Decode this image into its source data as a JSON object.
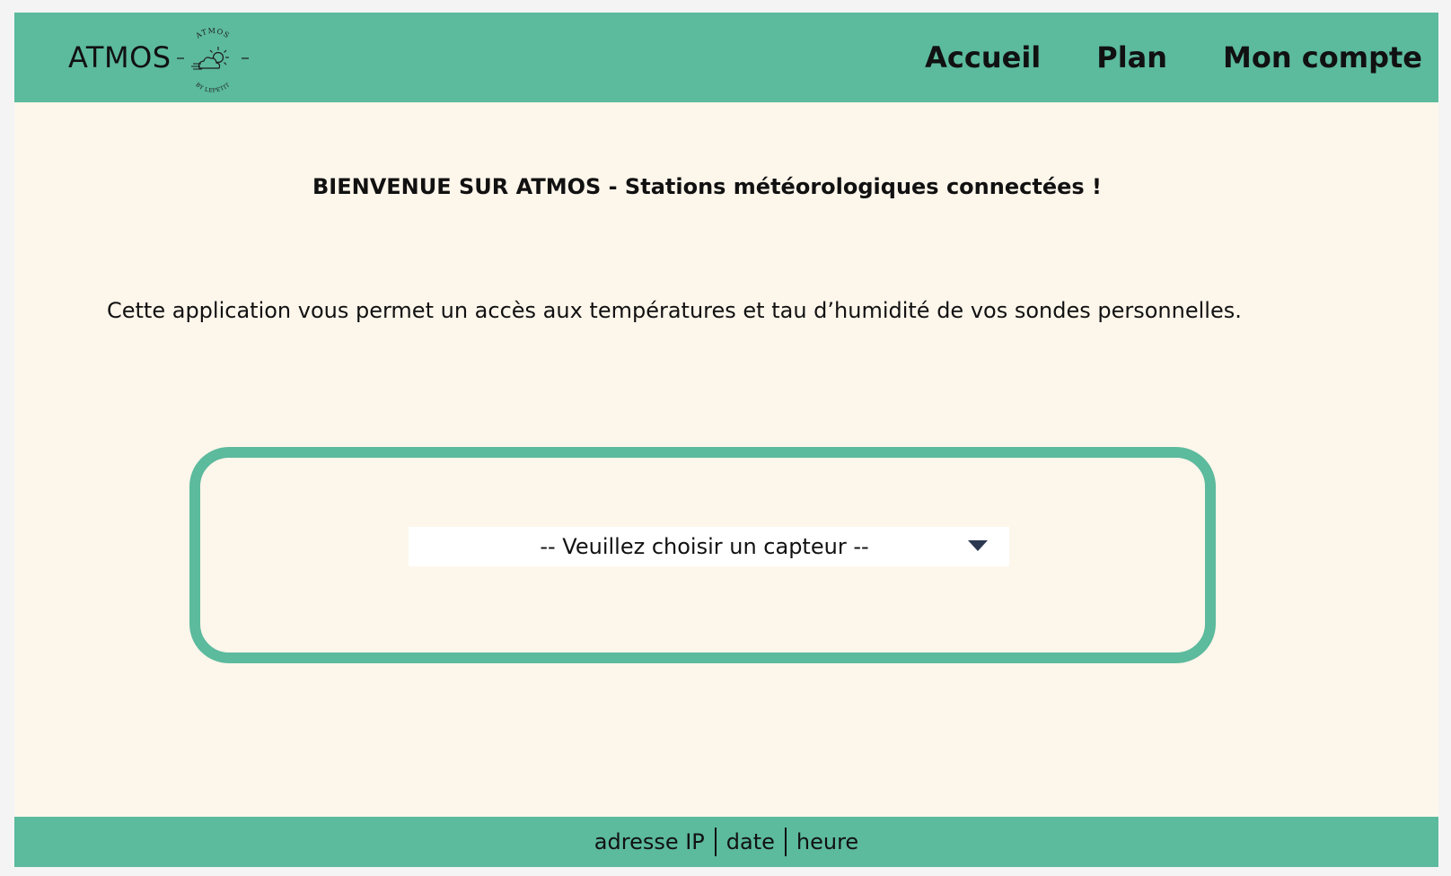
{
  "header": {
    "brand": "ATMOS",
    "logo": {
      "top_text": "ATMOS",
      "bottom_text": "BY LEPETIT",
      "icon": "sun-cloud-wind-icon"
    },
    "nav": [
      {
        "label": "Accueil"
      },
      {
        "label": "Plan"
      },
      {
        "label": "Mon compte"
      }
    ]
  },
  "main": {
    "welcome": "BIENVENUE SUR ATMOS - Stations météorologiques connectées !",
    "intro": "Cette application vous permet un accès aux températures et tau d’humidité de vos sondes personnelles.",
    "sensor_select": {
      "selected": "-- Veuillez choisir un capteur --",
      "icon": "chevron-down-icon"
    }
  },
  "footer": {
    "ip": "adresse IP",
    "date": "date",
    "time": "heure"
  },
  "colors": {
    "accent": "#5cba9d",
    "background": "#fdf6eb",
    "page": "#f4f4f4",
    "caret": "#2c3850"
  }
}
